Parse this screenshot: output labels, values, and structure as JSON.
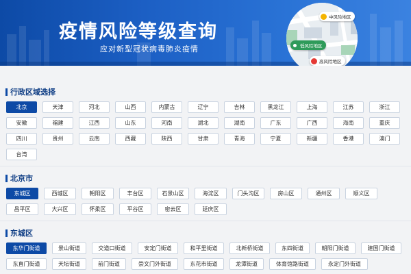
{
  "banner": {
    "title": "疫情风险等级查询",
    "subtitle": "应对新型冠状病毒肺炎疫情",
    "pins": {
      "mid": "中风险地区",
      "low": "低风险地区",
      "high": "高风险地区"
    }
  },
  "provinces": {
    "title": "行政区域选择",
    "selected": "北京",
    "items": [
      "北京",
      "天津",
      "河北",
      "山西",
      "内蒙古",
      "辽宁",
      "吉林",
      "黑龙江",
      "上海",
      "江苏",
      "浙江",
      "安徽",
      "福建",
      "江西",
      "山东",
      "河南",
      "湖北",
      "湖南",
      "广东",
      "广西",
      "海南",
      "重庆",
      "四川",
      "贵州",
      "云南",
      "西藏",
      "陕西",
      "甘肃",
      "青海",
      "宁夏",
      "新疆",
      "香港",
      "澳门",
      "台湾"
    ]
  },
  "districts": {
    "title": "北京市",
    "selected": "东城区",
    "items": [
      "东城区",
      "西城区",
      "朝阳区",
      "丰台区",
      "石景山区",
      "海淀区",
      "门头沟区",
      "房山区",
      "通州区",
      "顺义区",
      "昌平区",
      "大兴区",
      "怀柔区",
      "平谷区",
      "密云区",
      "延庆区"
    ]
  },
  "streets": {
    "title": "东城区",
    "selected": "东华门街道",
    "items": [
      "东华门街道",
      "景山街道",
      "交道口街道",
      "安定门街道",
      "和平里街道",
      "北新桥街道",
      "东四街道",
      "朝阳门街道",
      "建国门街道",
      "东直门街道",
      "天坛街道",
      "前门街道",
      "崇文门外街道",
      "东花市街道",
      "龙潭街道",
      "体育馆路街道",
      "永定门外街道"
    ]
  },
  "colors": {
    "brand": "#0d4aa6",
    "section_title": "#0d3c84",
    "chip_border": "#c9d3e0",
    "background": "#f2f3f5",
    "high_risk": "#e53935",
    "mid_risk": "#f4b400",
    "low_risk": "#2e9b5a"
  }
}
